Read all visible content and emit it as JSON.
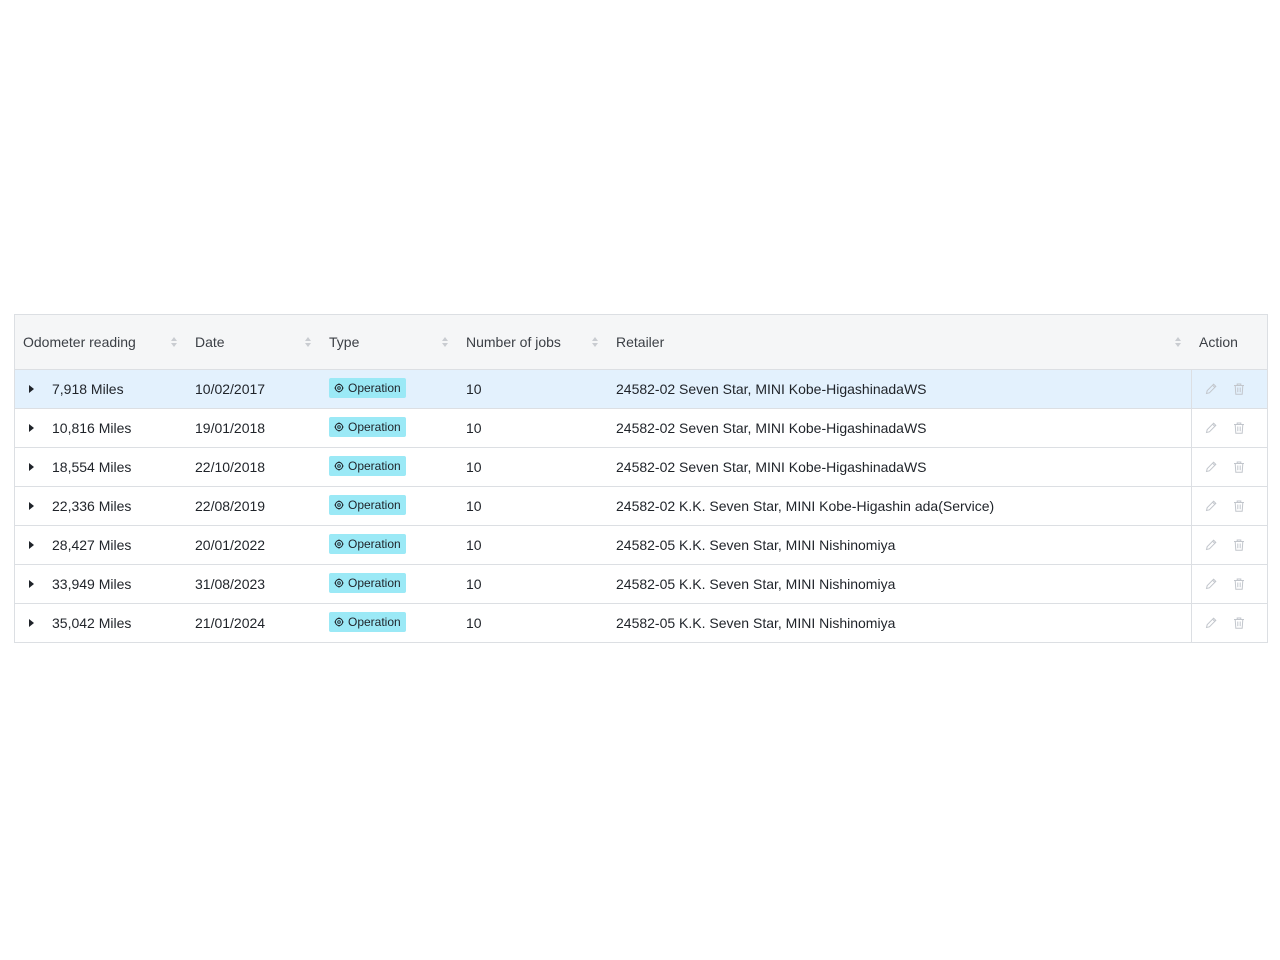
{
  "table": {
    "columns": [
      {
        "label": "Odometer reading",
        "sortable": true
      },
      {
        "label": "Date",
        "sortable": true
      },
      {
        "label": "Type",
        "sortable": true
      },
      {
        "label": "Number of jobs",
        "sortable": true
      },
      {
        "label": "Retailer",
        "sortable": true
      },
      {
        "label": "Action",
        "sortable": false
      }
    ],
    "rows": [
      {
        "odometer": "7,918 Miles",
        "date": "10/02/2017",
        "type": "Operation",
        "jobs": "10",
        "retailer": "24582-02 Seven Star, MINI Kobe-HigashinadaWS",
        "selected": true
      },
      {
        "odometer": "10,816 Miles",
        "date": "19/01/2018",
        "type": "Operation",
        "jobs": "10",
        "retailer": "24582-02 Seven Star, MINI Kobe-HigashinadaWS",
        "selected": false
      },
      {
        "odometer": "18,554 Miles",
        "date": "22/10/2018",
        "type": "Operation",
        "jobs": "10",
        "retailer": "24582-02 Seven Star, MINI Kobe-HigashinadaWS",
        "selected": false
      },
      {
        "odometer": "22,336 Miles",
        "date": "22/08/2019",
        "type": "Operation",
        "jobs": "10",
        "retailer": "24582-02 K.K. Seven Star, MINI Kobe-Higashin ada(Service)",
        "selected": false
      },
      {
        "odometer": "28,427 Miles",
        "date": "20/01/2022",
        "type": "Operation",
        "jobs": "10",
        "retailer": "24582-05 K.K. Seven Star, MINI Nishinomiya",
        "selected": false
      },
      {
        "odometer": "33,949 Miles",
        "date": "31/08/2023",
        "type": "Operation",
        "jobs": "10",
        "retailer": "24582-05 K.K. Seven Star, MINI Nishinomiya",
        "selected": false
      },
      {
        "odometer": "35,042 Miles",
        "date": "21/01/2024",
        "type": "Operation",
        "jobs": "10",
        "retailer": "24582-05 K.K. Seven Star, MINI Nishinomiya",
        "selected": false
      }
    ]
  },
  "icons": {
    "expand": "caret-right-icon",
    "type_badge": "gear-icon",
    "edit": "pencil-icon",
    "delete": "trash-icon",
    "sort": "sort-icon"
  },
  "colors": {
    "header_bg": "#f5f6f7",
    "selected_row_bg": "#e3f1fd",
    "badge_bg": "#9be9f6",
    "border": "#dcdfe3",
    "disabled_icon": "#c2c6cc"
  }
}
